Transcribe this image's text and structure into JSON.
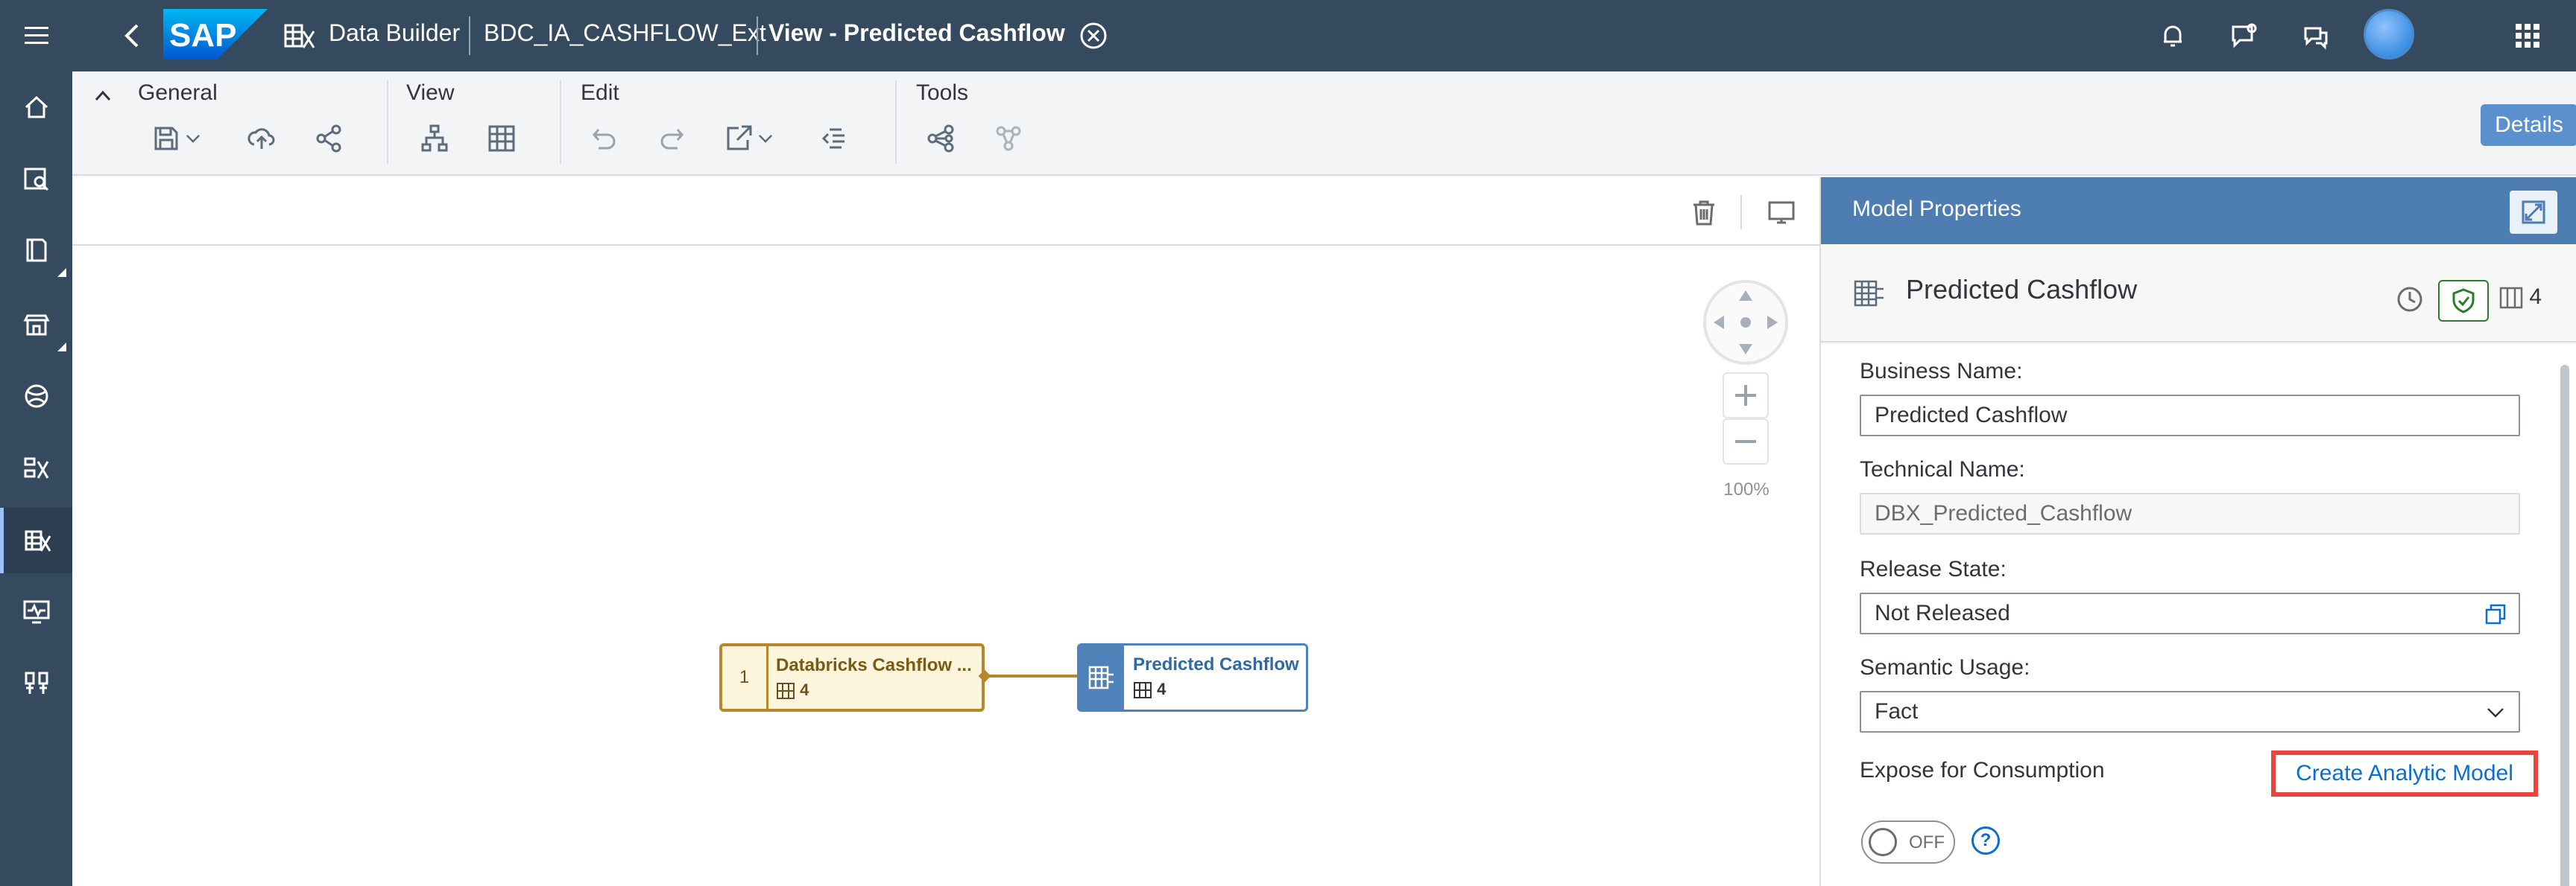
{
  "shell": {
    "logo_text": "SAP",
    "breadcrumb_app": "Data Builder",
    "breadcrumb_space": "BDC_IA_CASHFLOW_Ext",
    "view_title": "View - Predicted Cashflow"
  },
  "toolbar": {
    "groups": {
      "general": "General",
      "view": "View",
      "edit": "Edit",
      "tools": "Tools"
    },
    "details_label": "Details"
  },
  "canvas": {
    "zoom_level": "100%",
    "source_node": {
      "index": "1",
      "title": "Databricks Cashflow ...",
      "column_count": "4"
    },
    "target_node": {
      "title": "Predicted Cashflow",
      "column_count": "4"
    }
  },
  "panel": {
    "header_title": "Model Properties",
    "object_name": "Predicted Cashflow",
    "column_count": "4",
    "fields": {
      "business_name_label": "Business Name:",
      "business_name_value": "Predicted Cashflow",
      "technical_name_label": "Technical Name:",
      "technical_name_value": "DBX_Predicted_Cashflow",
      "release_state_label": "Release State:",
      "release_state_value": "Not Released",
      "semantic_usage_label": "Semantic Usage:",
      "semantic_usage_value": "Fact",
      "expose_label": "Expose for Consumption",
      "expose_toggle_text": "OFF",
      "help_glyph": "?"
    },
    "create_analytic_model_label": "Create Analytic Model"
  },
  "colors": {
    "shell_bg": "#354a5f",
    "panel_header_bg": "#4e7db1",
    "source_node_border": "#b8862b",
    "target_node_border": "#4e82b8",
    "link_blue": "#0a6ed1",
    "highlight_red": "#e8453c"
  }
}
